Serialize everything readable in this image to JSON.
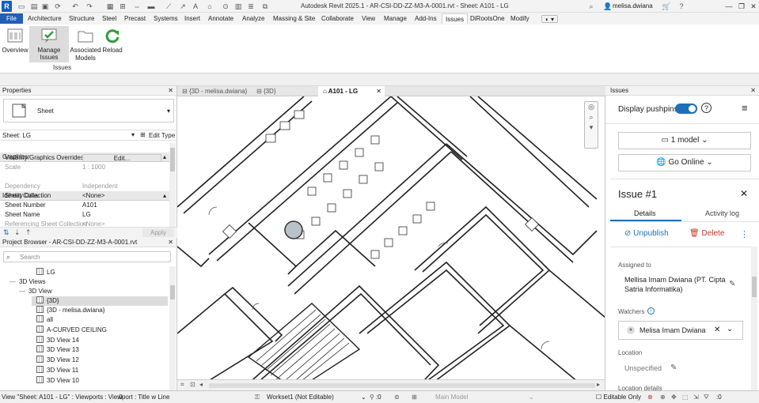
{
  "app": {
    "title": "Autodesk Revit 2025.1 - AR-CSI-DD-ZZ-M3-A-0001.rvt - Sheet: A101 - LG",
    "logo_letter": "R",
    "user": "melisa.dwiana"
  },
  "ribbon_tabs": [
    "File",
    "Architecture",
    "Structure",
    "Steel",
    "Precast",
    "Systems",
    "Insert",
    "Annotate",
    "Analyze",
    "Massing & Site",
    "Collaborate",
    "View",
    "Manage",
    "Add-Ins",
    "Issues",
    "DiRootsOne",
    "Modify"
  ],
  "active_tab": "Issues",
  "ribbon": {
    "buttons": [
      {
        "label": "Overview"
      },
      {
        "label": "Manage Issues"
      },
      {
        "label": "Associated Models"
      },
      {
        "label": "Reload"
      }
    ],
    "panel_label": "Issues"
  },
  "properties": {
    "title": "Properties",
    "type_name": "Sheet",
    "selector": "Sheet: LG",
    "edit_type": "Edit Type",
    "groups": [
      {
        "name": "Graphics",
        "rows": [
          {
            "key": "Visibility/Graphics Overrides",
            "value": "Edit..."
          },
          {
            "key": "Scale",
            "value": "1 : 1000"
          }
        ]
      },
      {
        "name": "Identity Data",
        "rows": [
          {
            "key": "Dependency",
            "value": "Independent"
          },
          {
            "key": "Sheet Collection",
            "value": "<None>"
          },
          {
            "key": "Sheet Number",
            "value": "A101"
          },
          {
            "key": "Sheet Name",
            "value": "LG"
          },
          {
            "key": "Referencing Sheet Collection",
            "value": "<None>"
          }
        ]
      }
    ],
    "apply": "Apply"
  },
  "browser": {
    "title": "Project Browser - AR-CSI-DD-ZZ-M3-A-0001.rvt",
    "search_placeholder": "Search",
    "items": [
      {
        "label": "LG",
        "level": 3
      },
      {
        "label": "3D Views",
        "level": 1
      },
      {
        "label": "3D View",
        "level": 2
      },
      {
        "label": "{3D}",
        "level": 3
      },
      {
        "label": "{3D - melisa.dwiana}",
        "level": 3
      },
      {
        "label": "all",
        "level": 3
      },
      {
        "label": "A-CURVED CEILING",
        "level": 3
      },
      {
        "label": "3D View 14",
        "level": 3
      },
      {
        "label": "3D View 13",
        "level": 3
      },
      {
        "label": "3D View 12",
        "level": 3
      },
      {
        "label": "3D View 11",
        "level": 3
      },
      {
        "label": "3D View 10",
        "level": 3
      }
    ]
  },
  "view_tabs": [
    {
      "label": "{3D - melisa.dwiana}",
      "active": false
    },
    {
      "label": "{3D}",
      "active": false
    },
    {
      "label": "A101 - LG",
      "active": true
    }
  ],
  "issues": {
    "title": "Issues",
    "display_pushpins": "Display pushpins",
    "models_btn": "1 model",
    "online_btn": "Go Online",
    "issue_title": "Issue #1",
    "tabs": [
      "Details",
      "Activity log"
    ],
    "unpublish": "Unpublish",
    "delete": "Delete",
    "assigned_label": "Assigned to",
    "assigned_value": "Mellisa Imam Dwiana (PT. Cipta Satria Informatika)",
    "watchers_label": "Watchers",
    "watcher_name": "Melisa Imam Dwiana",
    "location_label": "Location",
    "location_value": "Unspecified",
    "location_details_label": "Location details"
  },
  "status": {
    "message": "View \"Sheet: A101 - LG\" : Viewports : Viewport : Title w Line",
    "zero1": ":0",
    "workset": "Workset1 (Not Editable)",
    "model": "Main Model",
    "editable_only": "Editable Only",
    "zero2": ":0"
  },
  "colors": {
    "accent": "#1f6fb8",
    "delete_red": "#c0392b",
    "reload_green": "#2e9b3a"
  }
}
